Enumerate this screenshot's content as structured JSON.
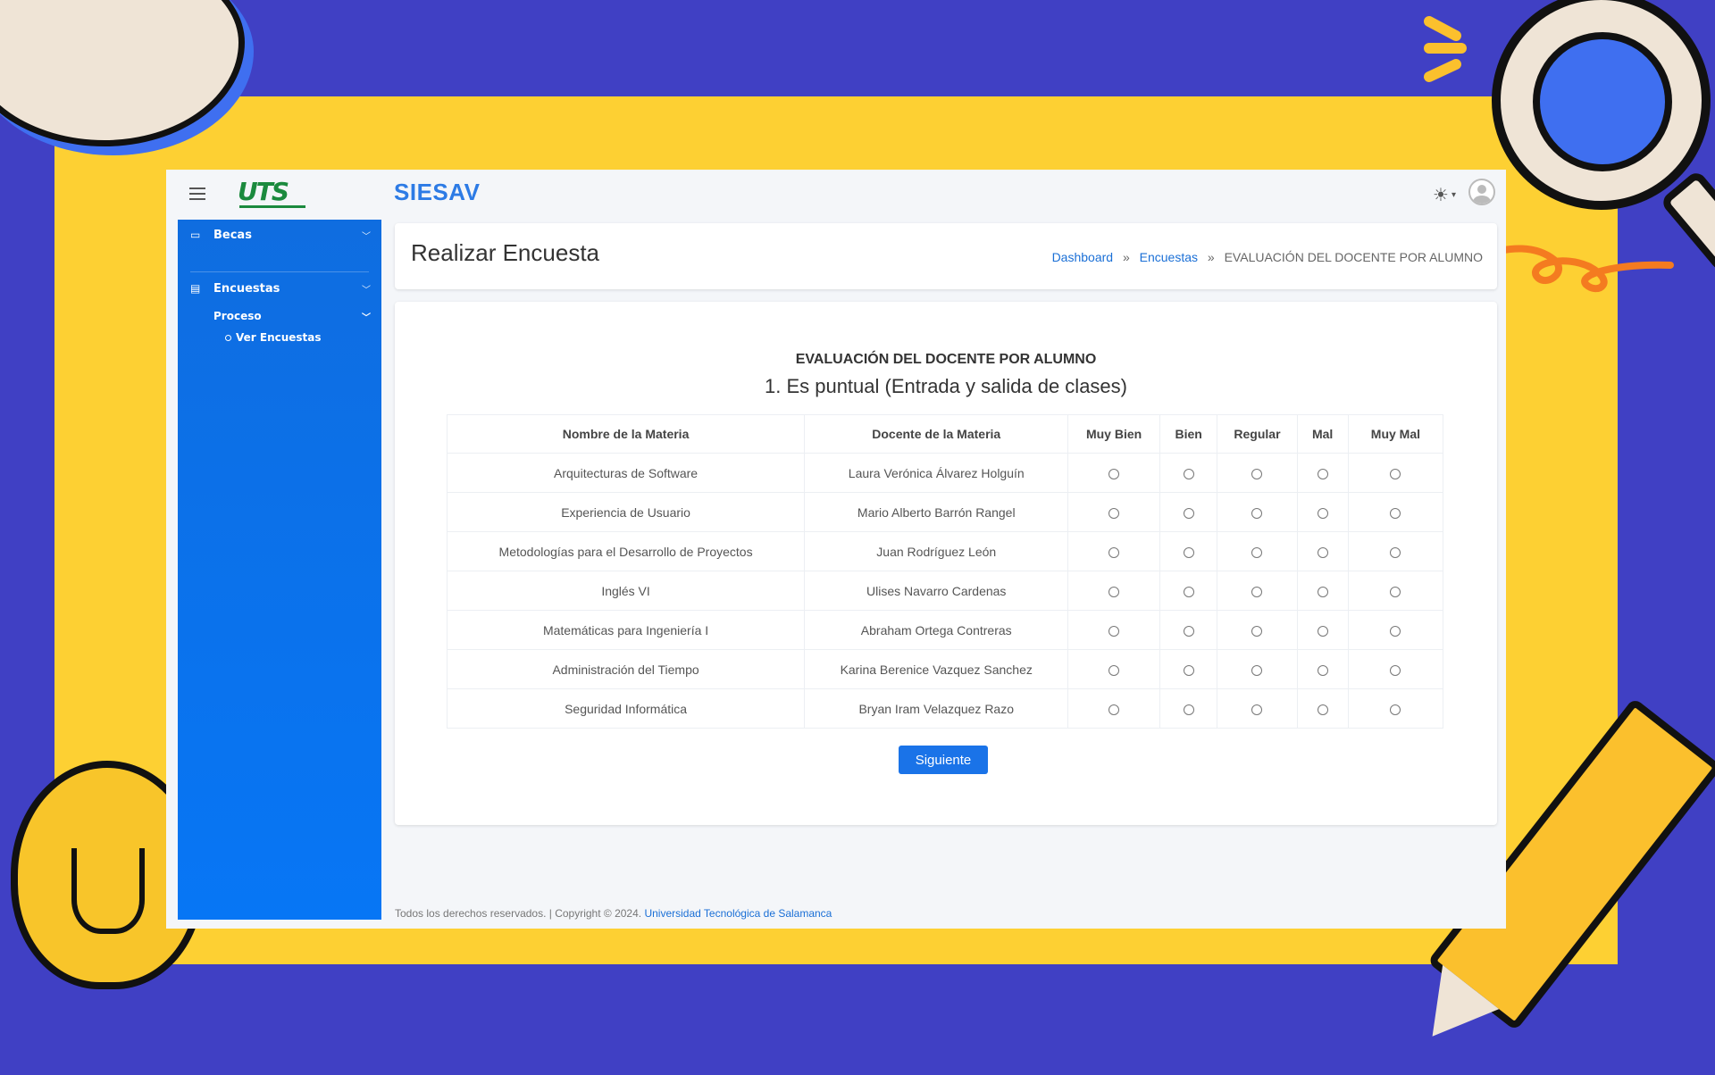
{
  "app": {
    "brand": "SIESAV",
    "logo_text": "UTS",
    "accent_color": "#1a73e8",
    "sidebar_color": "#0f6de0"
  },
  "header": {
    "menu_icon": "hamburger-icon",
    "theme_icon": "sun-icon",
    "avatar_icon": "user-avatar-icon"
  },
  "sidebar": {
    "items": [
      {
        "label": "Becas",
        "icon": "money-icon"
      },
      {
        "label": "Encuestas",
        "icon": "clipboard-icon"
      }
    ],
    "sub_items": [
      {
        "label": "Proceso"
      }
    ],
    "leaf_items": [
      {
        "label": "Ver Encuestas"
      }
    ]
  },
  "page": {
    "title": "Realizar Encuesta",
    "breadcrumb": {
      "dashboard": "Dashboard",
      "encuestas": "Encuestas",
      "current": "EVALUACIÓN DEL DOCENTE POR ALUMNO",
      "separator": "»"
    }
  },
  "survey": {
    "title": "EVALUACIÓN DEL DOCENTE POR ALUMNO",
    "question": "1. Es puntual (Entrada y salida de clases)",
    "columns": [
      "Nombre de la Materia",
      "Docente de la Materia",
      "Muy Bien",
      "Bien",
      "Regular",
      "Mal",
      "Muy Mal"
    ],
    "rows": [
      {
        "subject": "Arquitecturas de Software",
        "teacher": "Laura Verónica Álvarez Holguín"
      },
      {
        "subject": "Experiencia de Usuario",
        "teacher": "Mario Alberto Barrón Rangel"
      },
      {
        "subject": "Metodologías para el Desarrollo de Proyectos",
        "teacher": "Juan Rodríguez León"
      },
      {
        "subject": "Inglés VI",
        "teacher": "Ulises Navarro Cardenas"
      },
      {
        "subject": "Matemáticas para Ingeniería I",
        "teacher": "Abraham Ortega Contreras"
      },
      {
        "subject": "Administración del Tiempo",
        "teacher": "Karina Berenice Vazquez Sanchez"
      },
      {
        "subject": "Seguridad Informática",
        "teacher": "Bryan Iram Velazquez Razo"
      }
    ],
    "next_label": "Siguiente"
  },
  "footer": {
    "text": "Todos los derechos reservados. | Copyright © 2024.",
    "link": "Universidad Tecnológica de Salamanca"
  }
}
